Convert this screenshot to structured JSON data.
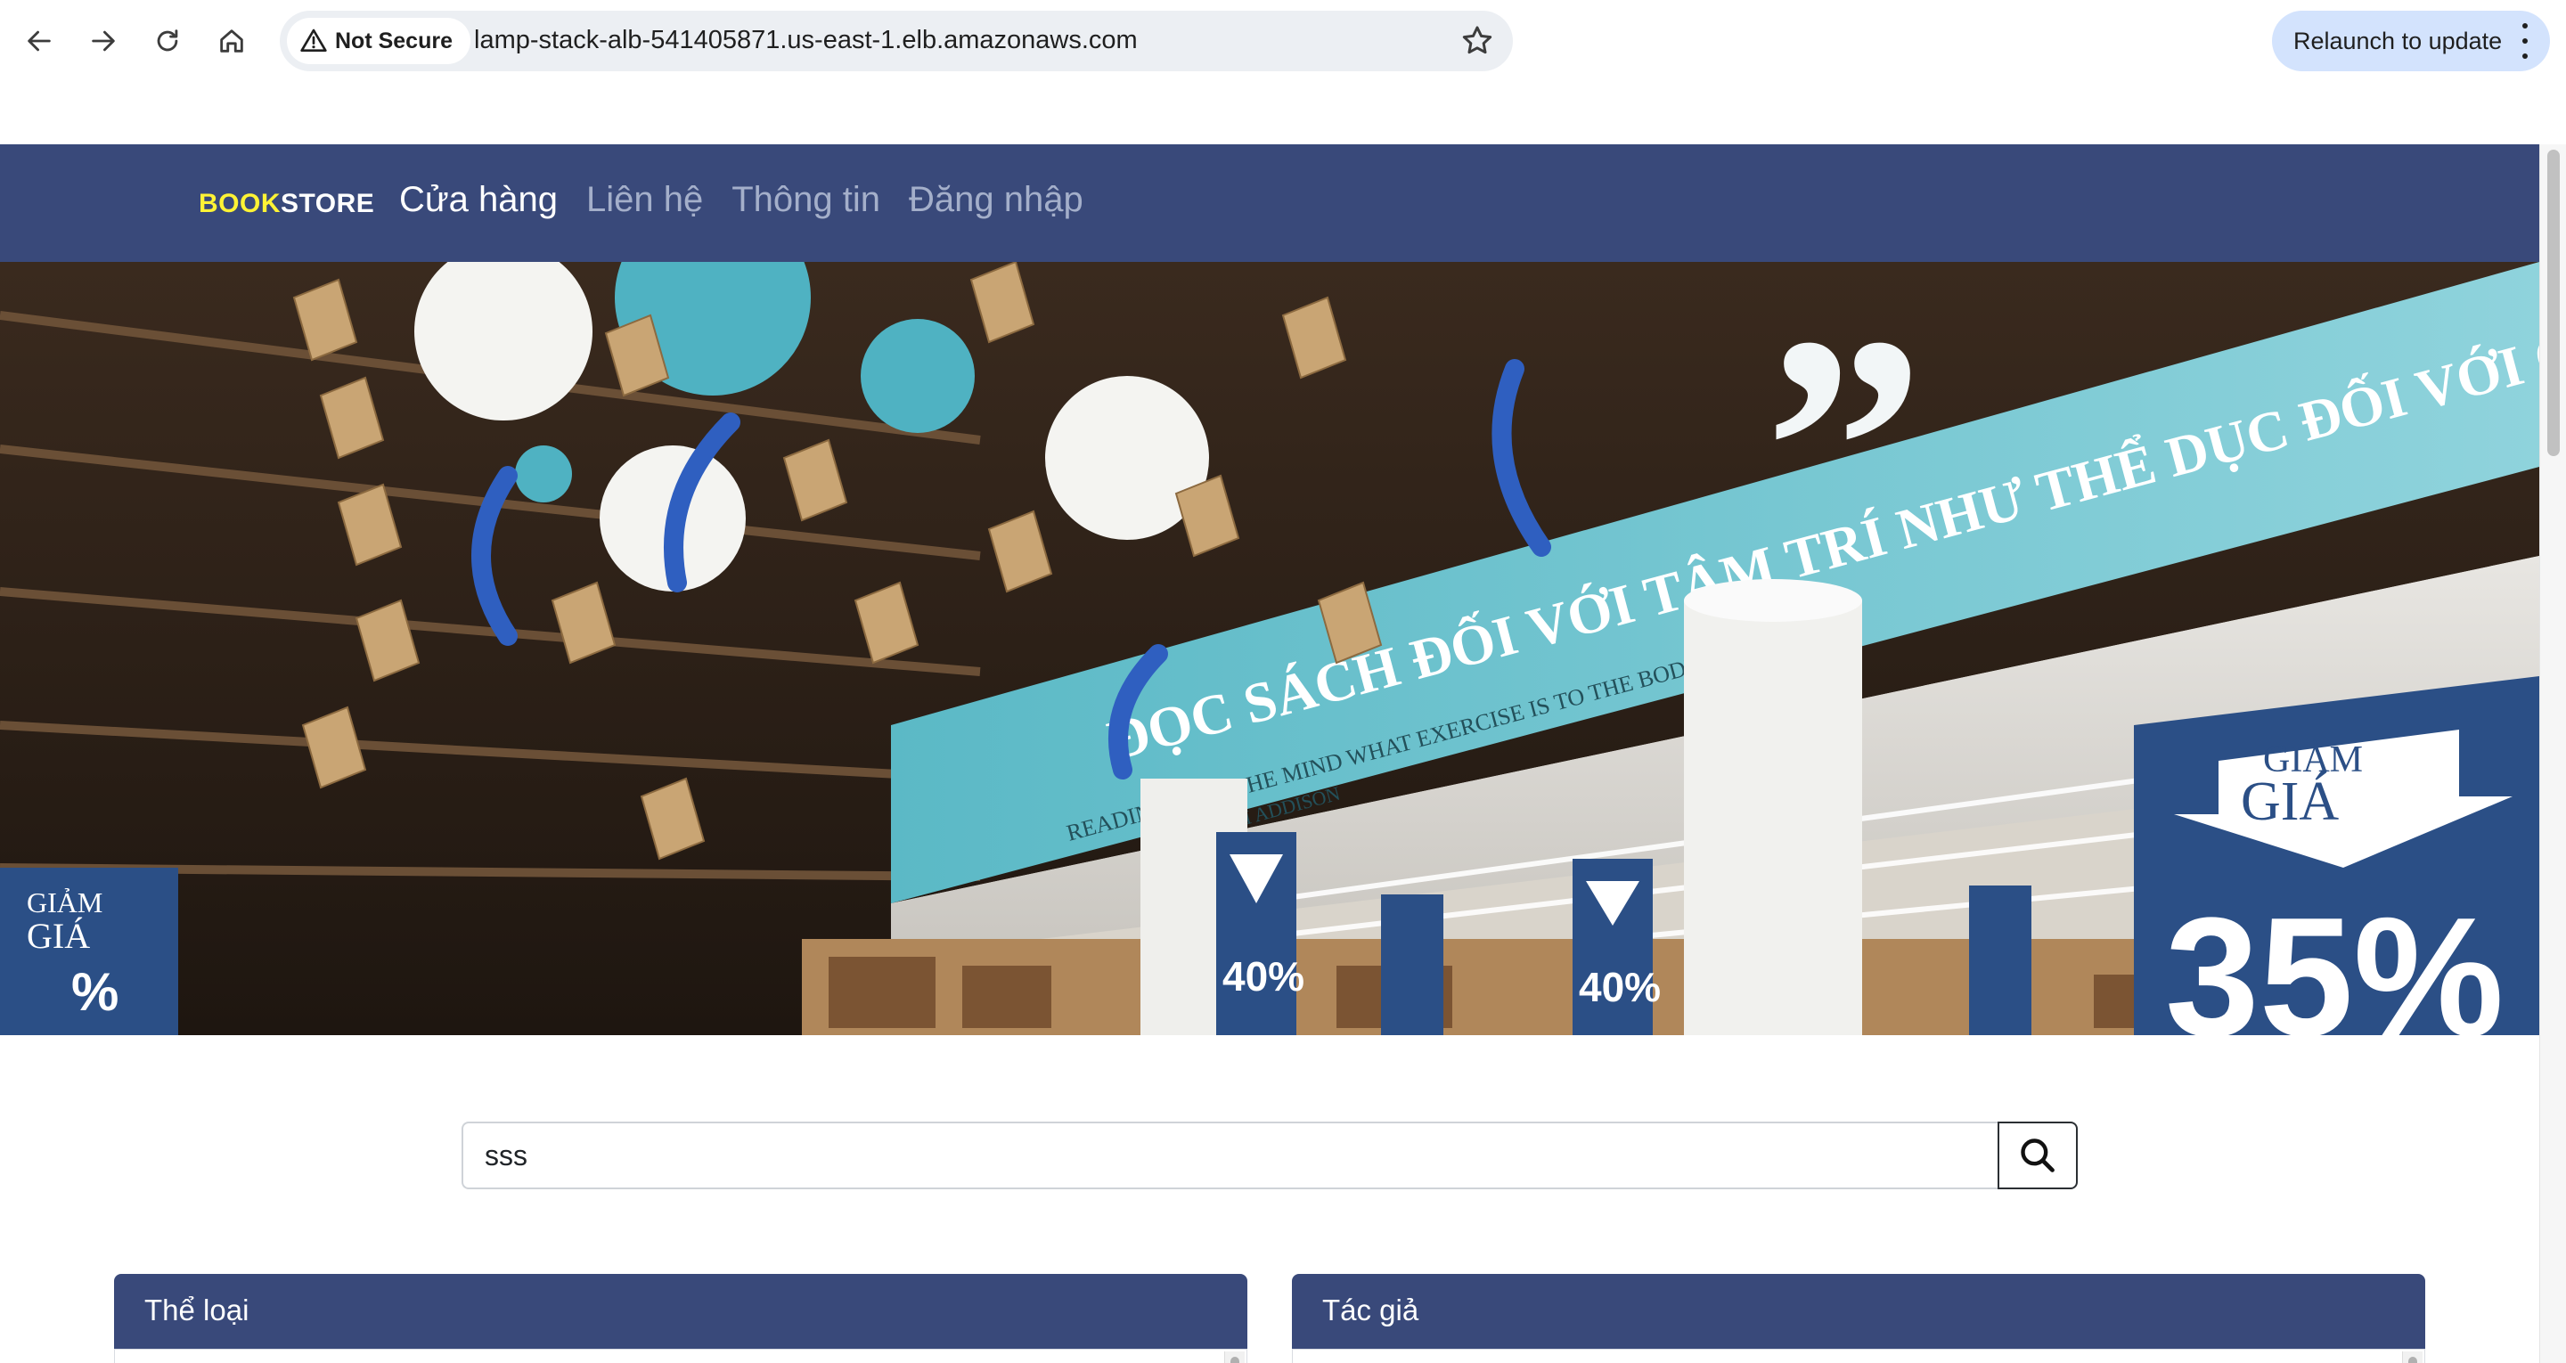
{
  "browser": {
    "security_label": "Not Secure",
    "url": "lamp-stack-alb-541405871.us-east-1.elb.amazonaws.com",
    "relaunch_label": "Relaunch to update"
  },
  "navbar": {
    "brand_part1": "BOOK",
    "brand_part2": "STORE",
    "brand_color": "#fff335",
    "background": "#39497a",
    "items": [
      {
        "label": "Cửa hàng",
        "active": true
      },
      {
        "label": "Liên hệ",
        "active": false
      },
      {
        "label": "Thông tin",
        "active": false
      },
      {
        "label": "Đăng nhập",
        "active": false
      }
    ]
  },
  "hero": {
    "banner_vi": "ĐỌC SÁCH ĐỐI VỚI TÂM TRÍ NHƯ THỂ DỤC ĐỐI VỚI CƠ THỂ",
    "banner_en": "READING IS TO THE MIND WHAT EXERCISE IS TO THE BODY",
    "banner_author": "JOSEPH ADDISON",
    "sale_word_1": "GIẢM",
    "sale_word_2": "GIÁ",
    "sale_big": "35%",
    "sale_small": "40%"
  },
  "search": {
    "value": "sss",
    "placeholder": ""
  },
  "panels": {
    "categories_title": "Thể loại",
    "authors_title": "Tác giả"
  }
}
